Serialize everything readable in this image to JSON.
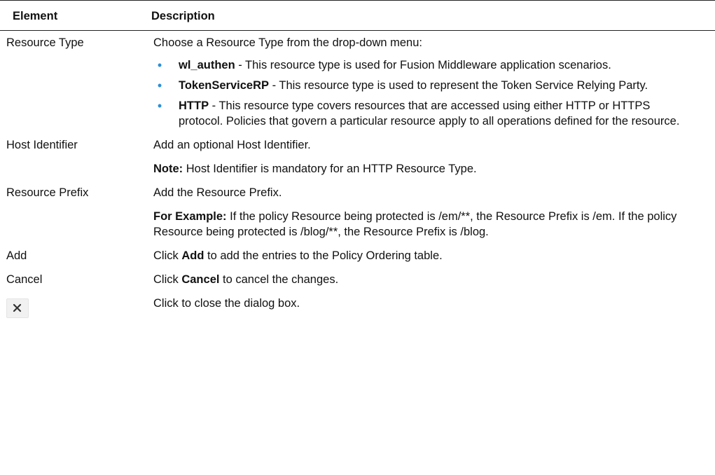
{
  "table": {
    "headers": {
      "element": "Element",
      "description": "Description"
    },
    "resource_type": {
      "element": "Resource Type",
      "intro": "Choose a Resource Type from the drop-down menu:",
      "bullets": [
        {
          "term": "wl_authen",
          "text": " - This resource type is used for Fusion Middleware application scenarios."
        },
        {
          "term": "TokenServiceRP",
          "text": " - This resource type is used to represent the Token Service Relying Party."
        },
        {
          "term": "HTTP",
          "text": " - This resource type covers resources that are accessed using either HTTP or HTTPS protocol. Policies that govern a particular resource apply to all operations defined for the resource."
        }
      ]
    },
    "host_identifier": {
      "element": "Host Identifier",
      "line1": "Add an optional Host Identifier.",
      "note_label": "Note:",
      "note_text": " Host Identifier is mandatory for an HTTP Resource Type."
    },
    "resource_prefix": {
      "element": "Resource Prefix",
      "line1": "Add the Resource Prefix.",
      "example_label": "For Example:",
      "example_text": " If the policy Resource being protected is /em/**, the Resource Prefix is /em. If the policy Resource being protected is /blog/**, the Resource Prefix is /blog."
    },
    "add": {
      "element": "Add",
      "pre": "Click ",
      "bold": "Add",
      "post": " to add the entries to the Policy Ordering table."
    },
    "cancel": {
      "element": "Cancel",
      "pre": "Click ",
      "bold": "Cancel",
      "post": " to cancel the changes."
    },
    "close": {
      "icon": "close-icon",
      "text": "Click to close the dialog box."
    }
  },
  "colors": {
    "bullet": "#2b8fd8",
    "rule": "#222222",
    "icon_bg": "#f1f1f1"
  }
}
